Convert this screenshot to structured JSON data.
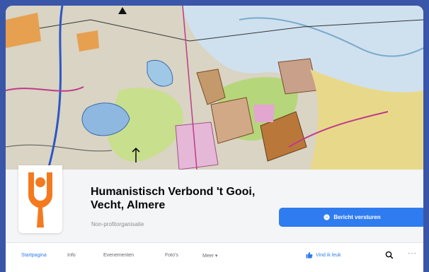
{
  "page": {
    "name": "Humanistisch Verbond 't Gooi, Vecht, Almere",
    "category": "Non-profitorganisatie"
  },
  "actions": {
    "send_message": "Bericht versturen"
  },
  "tabs": [
    {
      "label": "Startpagina",
      "active": true
    },
    {
      "label": "Info",
      "active": false
    },
    {
      "label": "Evenementen",
      "active": false
    },
    {
      "label": "Foto's",
      "active": false
    },
    {
      "label": "Meer",
      "active": false
    }
  ],
  "tab_bar": {
    "like_label": "Vind ik leuk",
    "more_glyph": "···"
  },
  "icons": {
    "avatar": "humanist-figure-logo",
    "send": "messenger-icon",
    "like": "thumbs-up-icon",
    "search": "search-icon",
    "more": "more-options-icon",
    "menu_chevron": "chevron-down-icon"
  },
  "colors": {
    "frame": "#3a56a8",
    "accent": "#2f7bf0",
    "logo": "#f47a20"
  }
}
